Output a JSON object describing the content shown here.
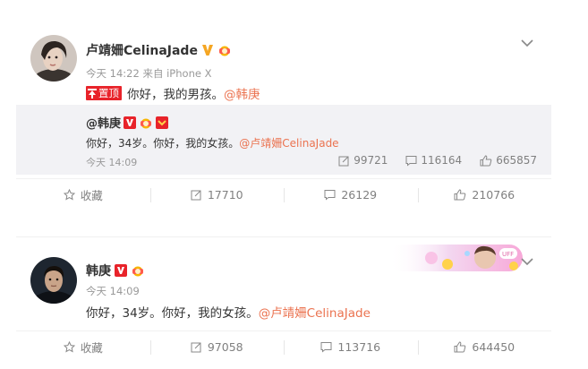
{
  "post1": {
    "author": "卢靖姍CelinaJade",
    "time": "今天 14:22",
    "source": "来自 iPhone X",
    "pin_label": "置顶",
    "text": "你好，我的男孩。",
    "mention": "@韩庚",
    "repost": {
      "author": "@韩庚",
      "text_plain": "你好，34岁。你好，我的女孩。",
      "text_mention": "@卢靖姍CelinaJade",
      "time": "今天 14:09",
      "reposts": "99721",
      "comments": "116164",
      "likes": "665857"
    },
    "actions": {
      "favorite": "收藏",
      "reposts": "17710",
      "comments": "26129",
      "likes": "210766"
    }
  },
  "post2": {
    "author": "韩庚",
    "time": "今天 14:09",
    "text": "你好，34岁。你好，我的女孩。",
    "mention": "@卢靖姍CelinaJade",
    "actions": {
      "favorite": "收藏",
      "reposts": "97058",
      "comments": "113716",
      "likes": "644450"
    }
  },
  "colors": {
    "mention": "#eb7350",
    "pin": "#e8232a",
    "meta": "#999999",
    "repost_bg": "#f2f2f5"
  },
  "icons": [
    "verified-v-icon",
    "medal-icon",
    "pin-icon",
    "chevron-down-icon",
    "star-icon",
    "repost-icon",
    "comment-icon",
    "like-icon"
  ]
}
